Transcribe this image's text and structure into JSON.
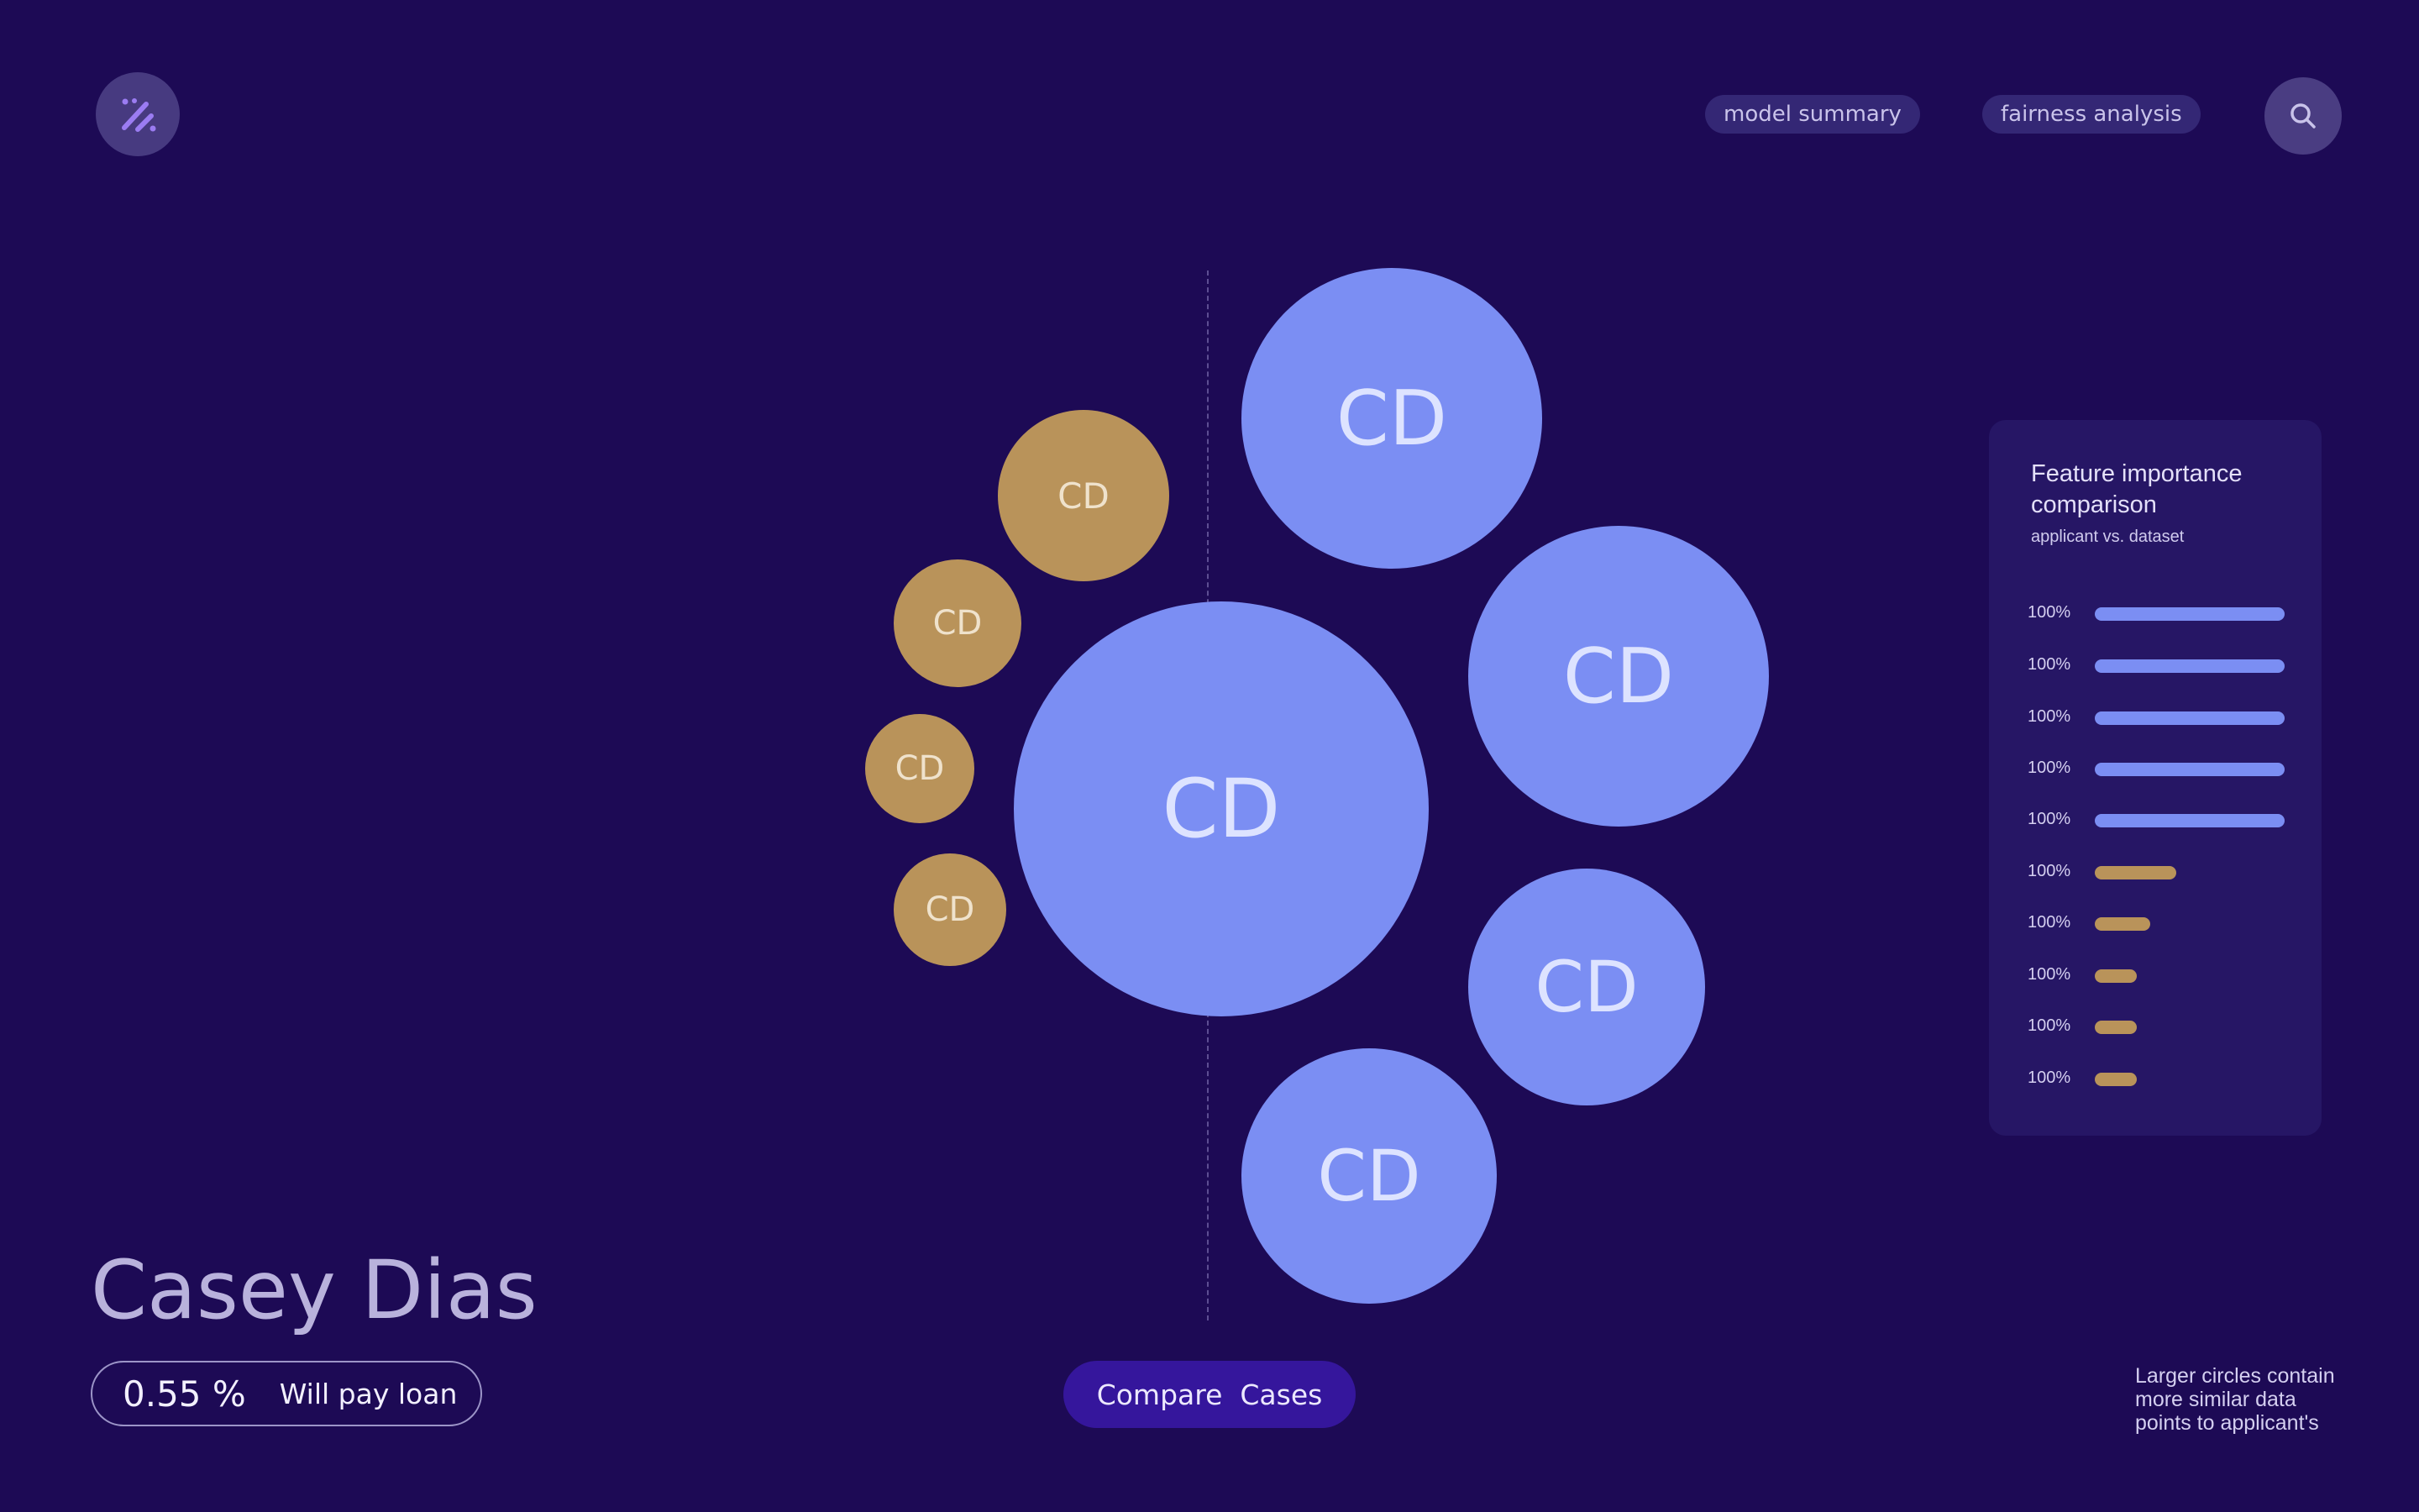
{
  "header": {
    "logo_icon": "percent-sparkle-icon",
    "nav": [
      {
        "label": "model summary"
      },
      {
        "label": "fairness analysis"
      }
    ],
    "search_icon": "search-icon"
  },
  "applicant": {
    "name": "Casey Dias",
    "probability": "0.55 %",
    "prediction": "Will pay loan"
  },
  "bubbles": {
    "center": {
      "label": "CD"
    },
    "right": [
      {
        "label": "CD"
      },
      {
        "label": "CD"
      },
      {
        "label": "CD"
      },
      {
        "label": "CD"
      }
    ],
    "left": [
      {
        "label": "CD"
      },
      {
        "label": "CD"
      },
      {
        "label": "CD"
      },
      {
        "label": "CD"
      }
    ]
  },
  "compare_button": {
    "label": "Compare  Cases"
  },
  "feature_panel": {
    "title": "Feature importance comparison",
    "subtitle": "applicant vs. dataset",
    "rows": [
      {
        "label": "100%",
        "value": 1.0,
        "group": "applicant"
      },
      {
        "label": "100%",
        "value": 1.0,
        "group": "applicant"
      },
      {
        "label": "100%",
        "value": 1.0,
        "group": "applicant"
      },
      {
        "label": "100%",
        "value": 1.0,
        "group": "applicant"
      },
      {
        "label": "100%",
        "value": 1.0,
        "group": "applicant"
      },
      {
        "label": "100%",
        "value": 0.43,
        "group": "dataset"
      },
      {
        "label": "100%",
        "value": 0.29,
        "group": "dataset"
      },
      {
        "label": "100%",
        "value": 0.22,
        "group": "dataset"
      },
      {
        "label": "100%",
        "value": 0.22,
        "group": "dataset"
      },
      {
        "label": "100%",
        "value": 0.22,
        "group": "dataset"
      }
    ]
  },
  "footnote": "Larger circles contain more similar data points to applicant's",
  "colors": {
    "background": "#1d0a55",
    "blue": "#7b8ef3",
    "gold": "#b9935a",
    "button": "#35169c"
  }
}
